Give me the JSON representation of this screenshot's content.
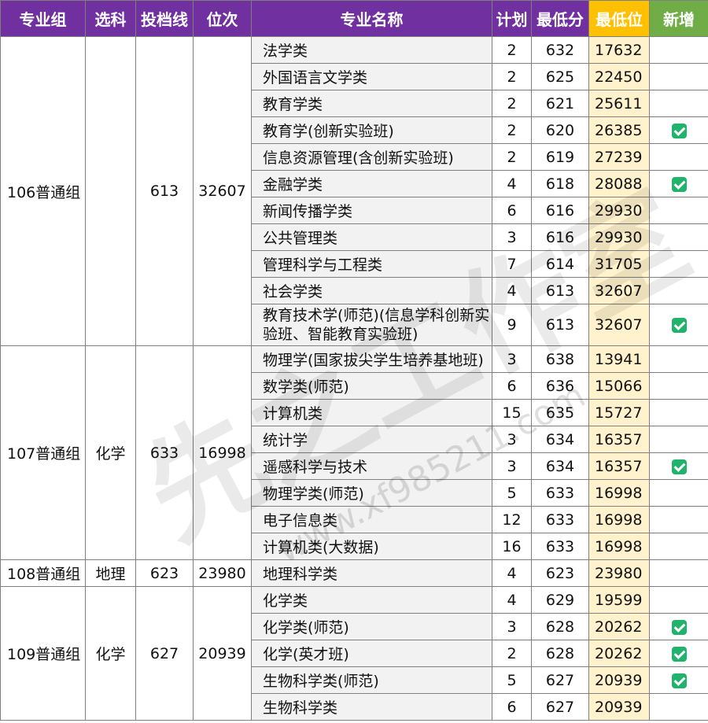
{
  "headers": [
    "专业组",
    "选科",
    "投档线",
    "位次",
    "专业名称",
    "计划",
    "最低分",
    "最低位",
    "新增"
  ],
  "groups": [
    {
      "name": "106普通组",
      "subject": "",
      "line": "613",
      "rank": "32607",
      "rows": [
        {
          "major": "法学类",
          "plan": "2",
          "score": "632",
          "pos": "17632",
          "isNew": false
        },
        {
          "major": "外国语言文学类",
          "plan": "2",
          "score": "625",
          "pos": "22450",
          "isNew": false
        },
        {
          "major": "教育学类",
          "plan": "2",
          "score": "621",
          "pos": "25611",
          "isNew": false
        },
        {
          "major": "教育学(创新实验班)",
          "plan": "2",
          "score": "620",
          "pos": "26385",
          "isNew": true
        },
        {
          "major": "信息资源管理(含创新实验班)",
          "plan": "2",
          "score": "619",
          "pos": "27239",
          "isNew": false
        },
        {
          "major": "金融学类",
          "plan": "4",
          "score": "618",
          "pos": "28088",
          "isNew": true
        },
        {
          "major": "新闻传播学类",
          "plan": "6",
          "score": "616",
          "pos": "29930",
          "isNew": false
        },
        {
          "major": "公共管理类",
          "plan": "3",
          "score": "616",
          "pos": "29930",
          "isNew": false
        },
        {
          "major": "管理科学与工程类",
          "plan": "7",
          "score": "614",
          "pos": "31705",
          "isNew": false
        },
        {
          "major": "社会学类",
          "plan": "4",
          "score": "613",
          "pos": "32607",
          "isNew": false
        },
        {
          "major": "教育技术学(师范)(信息学科创新实验班、智能教育实验班)",
          "plan": "9",
          "score": "613",
          "pos": "32607",
          "isNew": true,
          "tall": true
        }
      ]
    },
    {
      "name": "107普通组",
      "subject": "化学",
      "line": "633",
      "rank": "16998",
      "rows": [
        {
          "major": "物理学(国家拔尖学生培养基地班)",
          "plan": "3",
          "score": "638",
          "pos": "13941",
          "isNew": false
        },
        {
          "major": "数学类(师范)",
          "plan": "6",
          "score": "636",
          "pos": "15066",
          "isNew": false
        },
        {
          "major": "计算机类",
          "plan": "15",
          "score": "635",
          "pos": "15727",
          "isNew": false
        },
        {
          "major": "统计学",
          "plan": "3",
          "score": "634",
          "pos": "16357",
          "isNew": false
        },
        {
          "major": "遥感科学与技术",
          "plan": "3",
          "score": "634",
          "pos": "16357",
          "isNew": true
        },
        {
          "major": "物理学类(师范)",
          "plan": "5",
          "score": "633",
          "pos": "16998",
          "isNew": false
        },
        {
          "major": "电子信息类",
          "plan": "12",
          "score": "633",
          "pos": "16998",
          "isNew": false
        },
        {
          "major": "计算机类(大数据)",
          "plan": "16",
          "score": "633",
          "pos": "16998",
          "isNew": false
        }
      ]
    },
    {
      "name": "108普通组",
      "subject": "地理",
      "line": "623",
      "rank": "23980",
      "rows": [
        {
          "major": "地理科学类",
          "plan": "4",
          "score": "623",
          "pos": "23980",
          "isNew": false
        }
      ]
    },
    {
      "name": "109普通组",
      "subject": "化学",
      "line": "627",
      "rank": "20939",
      "rows": [
        {
          "major": "化学类",
          "plan": "4",
          "score": "629",
          "pos": "19599",
          "isNew": false
        },
        {
          "major": "化学类(师范)",
          "plan": "3",
          "score": "628",
          "pos": "20262",
          "isNew": true
        },
        {
          "major": "化学(英才班)",
          "plan": "2",
          "score": "628",
          "pos": "20262",
          "isNew": true
        },
        {
          "major": "生物科学类(师范)",
          "plan": "5",
          "score": "627",
          "pos": "20939",
          "isNew": true
        },
        {
          "major": "生物科学类",
          "plan": "6",
          "score": "627",
          "pos": "20939",
          "isNew": false
        }
      ]
    }
  ],
  "watermark": {
    "brand": "先之工作室",
    "url": "www.xf985211.com"
  },
  "colors": {
    "header": "#7030a0",
    "highlight_header": "#ffc000",
    "new_header": "#70ad47",
    "highlight_col": "#fff2cc",
    "check": "#21b36c"
  }
}
